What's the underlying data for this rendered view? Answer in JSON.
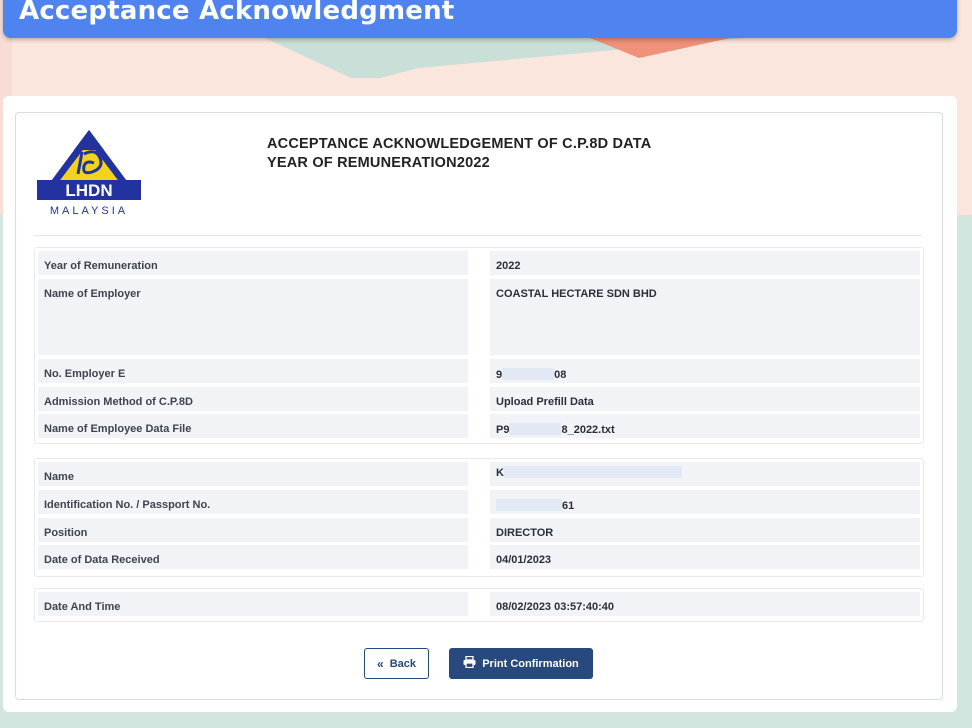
{
  "page": {
    "title": "Acceptance Acknowledgment"
  },
  "logo": {
    "text": "LHDN",
    "subtext": "MALAYSIA",
    "icon": "lhdn-logo"
  },
  "heading": {
    "line1": "ACCEPTANCE ACKNOWLEDGEMENT OF C.P.8D DATA",
    "line2": "YEAR OF REMUNERATION2022"
  },
  "employer_section": [
    {
      "label": "Year of Remuneration",
      "value": "2022"
    },
    {
      "label": "Name of Employer",
      "value": "COASTAL HECTARE SDN BHD"
    },
    {
      "label": "No. Employer E",
      "value_prefix": "9",
      "value_suffix": "08",
      "redacted": true
    },
    {
      "label": "Admission Method of C.P.8D",
      "value": "Upload Prefill Data"
    },
    {
      "label": "Name of Employee Data File",
      "value_prefix": "P9",
      "value_suffix": "8_2022.txt",
      "redacted": true
    }
  ],
  "employee_section": [
    {
      "label": "Name",
      "value_prefix": "K",
      "value_suffix": "",
      "redacted": true
    },
    {
      "label": "Identification No. / Passport No.",
      "value_prefix": "",
      "value_suffix": "61",
      "redacted": true
    },
    {
      "label": "Position",
      "value": "DIRECTOR"
    },
    {
      "label": "Date of Data Received",
      "value": "04/01/2023"
    }
  ],
  "timestamp_section": [
    {
      "label": "Date And Time",
      "value": "08/02/2023 03:57:40:40"
    }
  ],
  "buttons": {
    "back": {
      "label": "Back",
      "icon": "double-chevron-left-icon"
    },
    "print": {
      "label": "Print Confirmation",
      "icon": "printer-icon"
    }
  },
  "colors": {
    "title_bar": "#4f83f0",
    "primary_button": "#27497e",
    "cell_background": "#f1f3f6",
    "page_background_top": "#fbe6dd",
    "page_background_bottom": "#d3e5df",
    "logo_blue": "#2233a0",
    "logo_yellow": "#f3d21b"
  }
}
